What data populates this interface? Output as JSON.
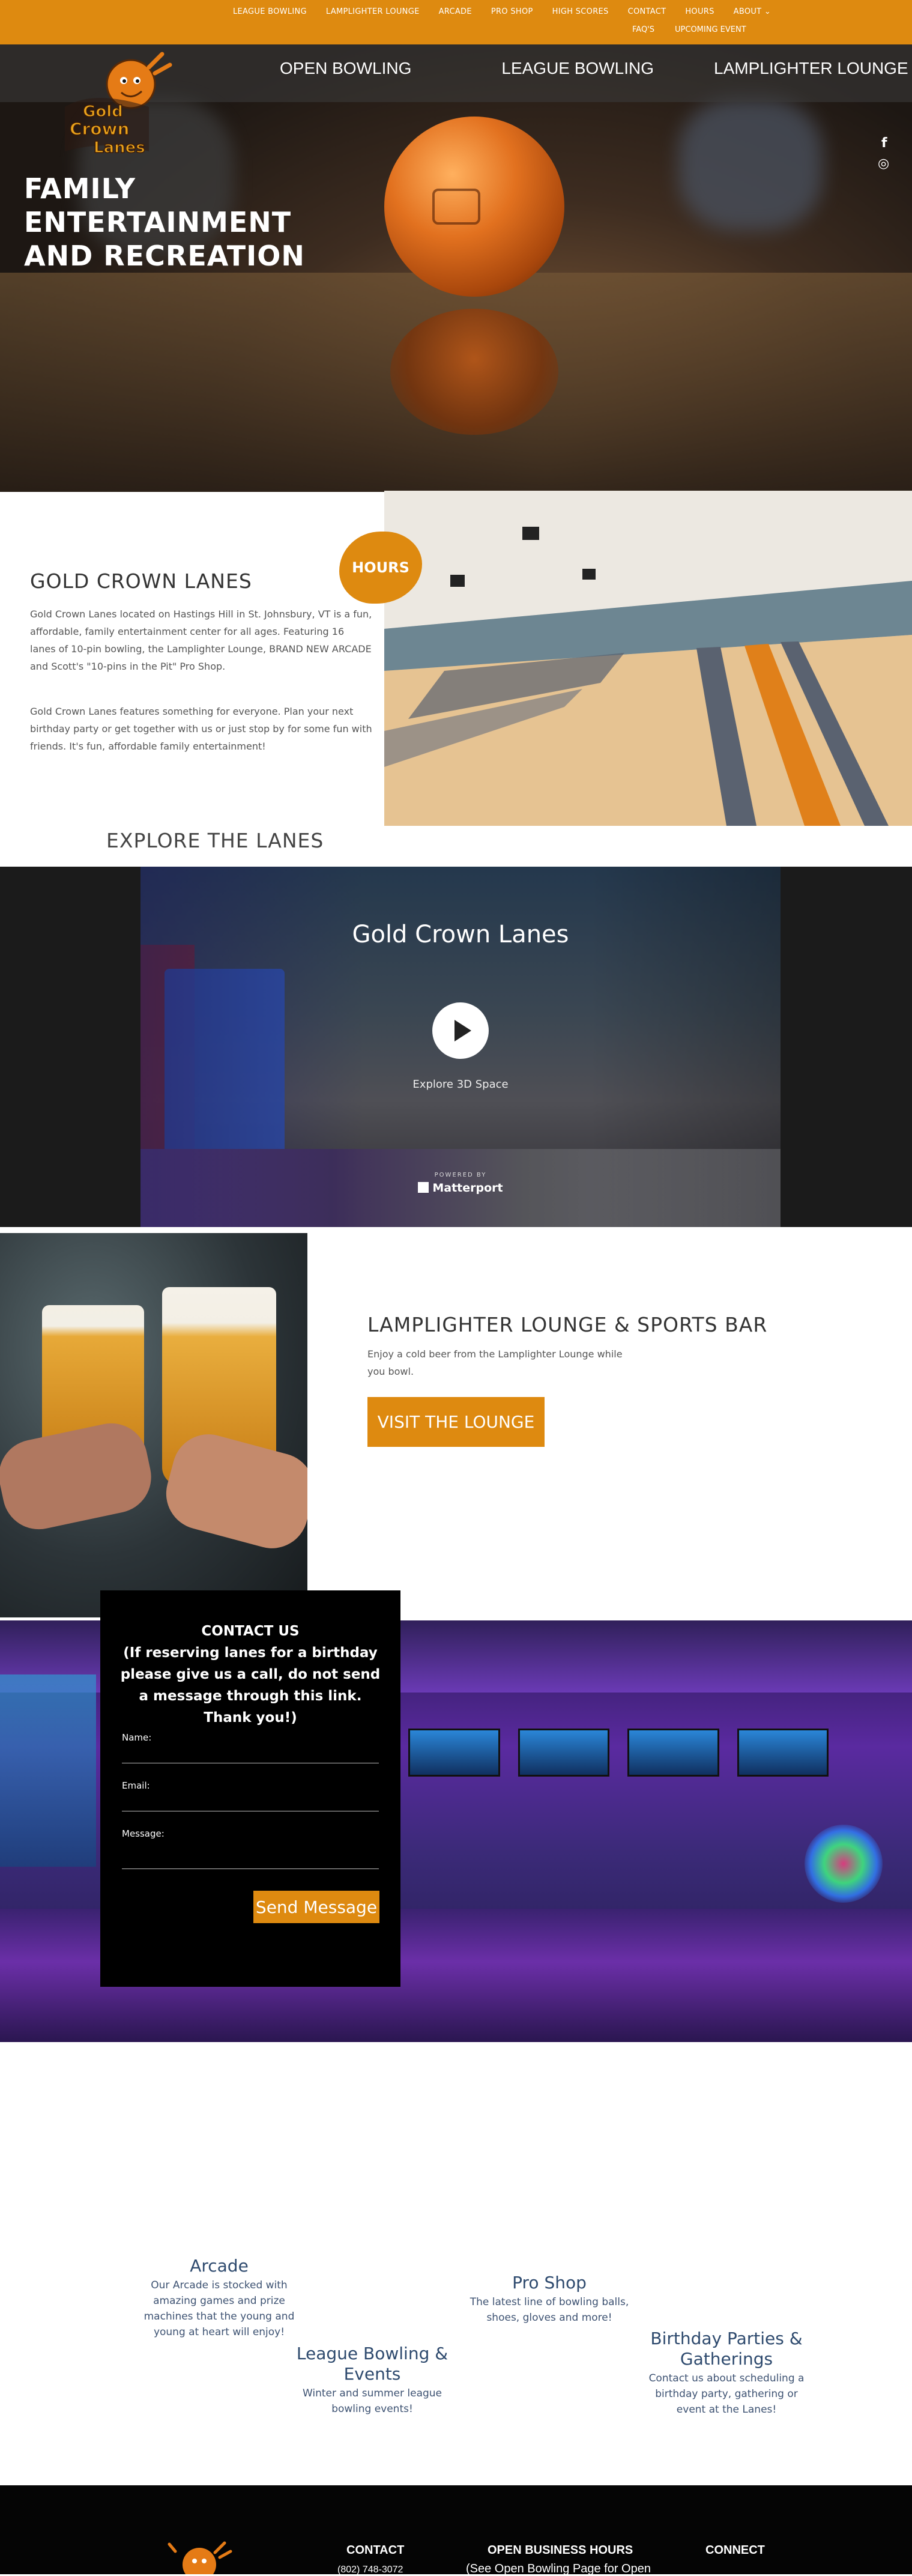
{
  "topnav": {
    "row1": [
      "LEAGUE BOWLING",
      "LAMPLIGHTER LOUNGE",
      "ARCADE",
      "PRO SHOP",
      "HIGH SCORES",
      "CONTACT",
      "HOURS",
      "ABOUT ⌄"
    ],
    "row2": [
      "FAQ'S",
      "UPCOMING EVENT"
    ]
  },
  "mainnav": [
    "OPEN BOWLING",
    "LEAGUE BOWLING",
    "LAMPLIGHTER LOUNGE"
  ],
  "logo": {
    "line1": "Gold",
    "line2": "Crown",
    "line3": "Lanes"
  },
  "hero": {
    "title_lines": [
      "FAMILY",
      "ENTERTAINMENT",
      "AND RECREATION"
    ]
  },
  "social": {
    "facebook": "f",
    "instagram": "◎",
    "icons": [
      "facebook-icon",
      "instagram-icon"
    ]
  },
  "goldcrown": {
    "title": "GOLD CROWN LANES",
    "para1": "Gold Crown Lanes located on Hastings Hill in St. Johnsbury, VT is a fun, affordable, family entertainment center for all ages. Featuring 16 lanes of 10-pin bowling, the Lamplighter Lounge, BRAND NEW ARCADE and Scott's \"10-pins in the Pit\" Pro Shop.",
    "para2": "Gold Crown Lanes features something for everyone. Plan your next birthday party or get together with us or just stop by for some fun with friends. It's fun, affordable family entertainment!",
    "hours_label": "HOURS"
  },
  "explore": {
    "title": "EXPLORE THE LANES",
    "tour_title": "Gold Crown Lanes",
    "tour_action": "Explore 3D Space",
    "powered_by": "POWERED BY",
    "brand": "Matterport"
  },
  "lounge": {
    "title": "LAMPLIGHTER LOUNGE & SPORTS BAR",
    "text": "Enjoy a cold beer from the Lamplighter Lounge while you bowl.",
    "button": "VISIT THE LOUNGE"
  },
  "contact": {
    "title_line1": "CONTACT US",
    "title_line2": "(If reserving lanes for a birthday please give us a call, do not send a message through this link.  Thank you!)",
    "name_label": "Name:",
    "email_label": "Email:",
    "message_label": "Message:",
    "name_value": "",
    "email_value": "",
    "message_value": "",
    "send_label": "Send Message"
  },
  "services": {
    "arcade": {
      "title": "Arcade",
      "desc": "Our Arcade is stocked with amazing games and prize machines that the young and young at heart will enjoy!"
    },
    "proshop": {
      "title": "Pro Shop",
      "desc": "The latest line of bowling balls, shoes, gloves and more!"
    },
    "league": {
      "title": "League Bowling & Events",
      "desc": "Winter and summer league bowling events!"
    },
    "birthday": {
      "title": "Birthday Parties & Gatherings",
      "desc": "Contact us about scheduling a birthday party, gathering or event at the Lanes!"
    }
  },
  "footer": {
    "contact_heading": "CONTACT",
    "contact_phone": "(802) 748-3072",
    "hours_heading": "OPEN BUSINESS HOURS",
    "hours_sub": "(See Open Bowling Page for Open",
    "connect_heading": "CONNECT"
  },
  "colors": {
    "accent": "#de8a10",
    "dark": "#1b1b1b",
    "service_text": "#2e4a6e"
  }
}
